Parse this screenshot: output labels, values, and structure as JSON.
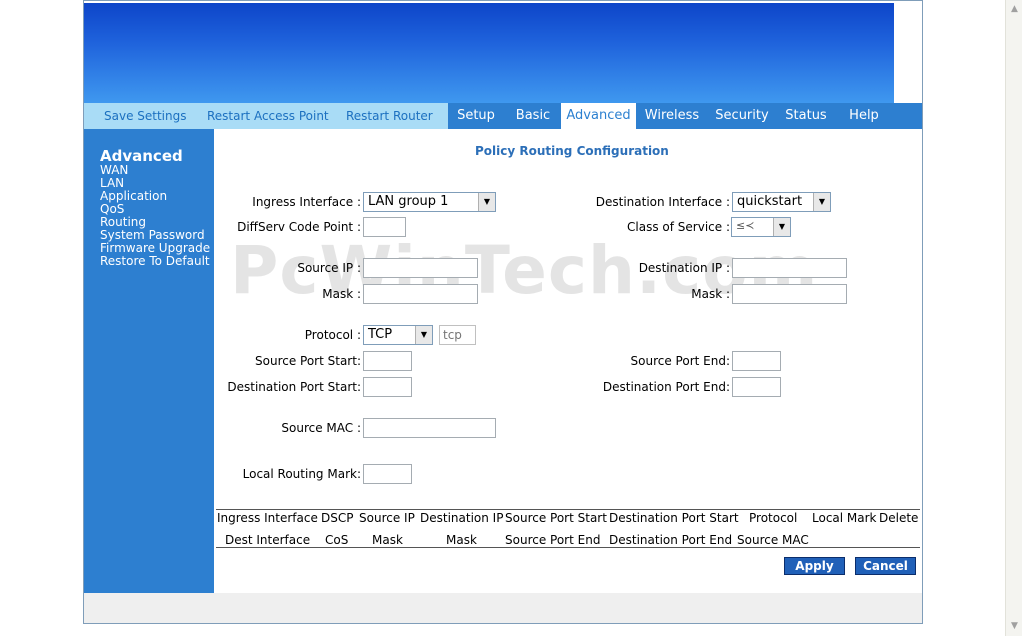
{
  "nav": {
    "links": [
      "Save Settings",
      "Restart Access Point",
      "Restart Router"
    ],
    "tabs": [
      "Setup",
      "Basic",
      "Advanced",
      "Wireless",
      "Security",
      "Status",
      "Help"
    ],
    "active_tab": "Advanced"
  },
  "sidebar": {
    "title": "Advanced",
    "items": [
      "WAN",
      "LAN",
      "Application",
      "QoS",
      "Routing",
      "System Password",
      "Firmware Upgrade",
      "Restore To Default"
    ]
  },
  "page": {
    "title": "Policy Routing Configuration"
  },
  "watermark": "PcWinTech.com",
  "form": {
    "ingress_interface": {
      "label": "Ingress Interface :",
      "value": "LAN group 1"
    },
    "destination_interface": {
      "label": "Destination Interface :",
      "value": "quickstart"
    },
    "diffserv": {
      "label": "DiffServ Code Point :",
      "value": ""
    },
    "class_of_service": {
      "label": "Class of Service :",
      "value": ""
    },
    "source_ip": {
      "label": "Source IP :",
      "value": ""
    },
    "source_mask": {
      "label": "Mask :",
      "value": ""
    },
    "destination_ip": {
      "label": "Destination IP :",
      "value": ""
    },
    "destination_mask": {
      "label": "Mask :",
      "value": ""
    },
    "protocol": {
      "label": "Protocol :",
      "value": "TCP",
      "text_placeholder": "tcp"
    },
    "source_port_start": {
      "label": "Source Port Start:",
      "value": ""
    },
    "source_port_end": {
      "label": "Source Port End:",
      "value": ""
    },
    "dest_port_start": {
      "label": "Destination Port Start:",
      "value": ""
    },
    "dest_port_end": {
      "label": "Destination Port End:",
      "value": ""
    },
    "source_mac": {
      "label": "Source MAC :",
      "value": ""
    },
    "local_routing_mark": {
      "label": "Local Routing Mark:",
      "value": ""
    }
  },
  "table": {
    "header_row1": [
      "Ingress Interface",
      "DSCP",
      "Source IP",
      "Destination IP",
      "Source Port Start",
      "Destination Port Start",
      "Protocol",
      "Local Mark",
      "Delete"
    ],
    "header_row2": [
      "Dest Interface",
      "CoS",
      "Mask",
      "Mask",
      "Source Port End",
      "Destination Port End",
      "Source MAC"
    ]
  },
  "buttons": {
    "apply": "Apply",
    "cancel": "Cancel"
  },
  "colors": {
    "nav_blue": "#2d7fd0",
    "nav_light": "#a9dcf6",
    "title_blue": "#2c6fb8",
    "button_blue": "#2060b8"
  }
}
